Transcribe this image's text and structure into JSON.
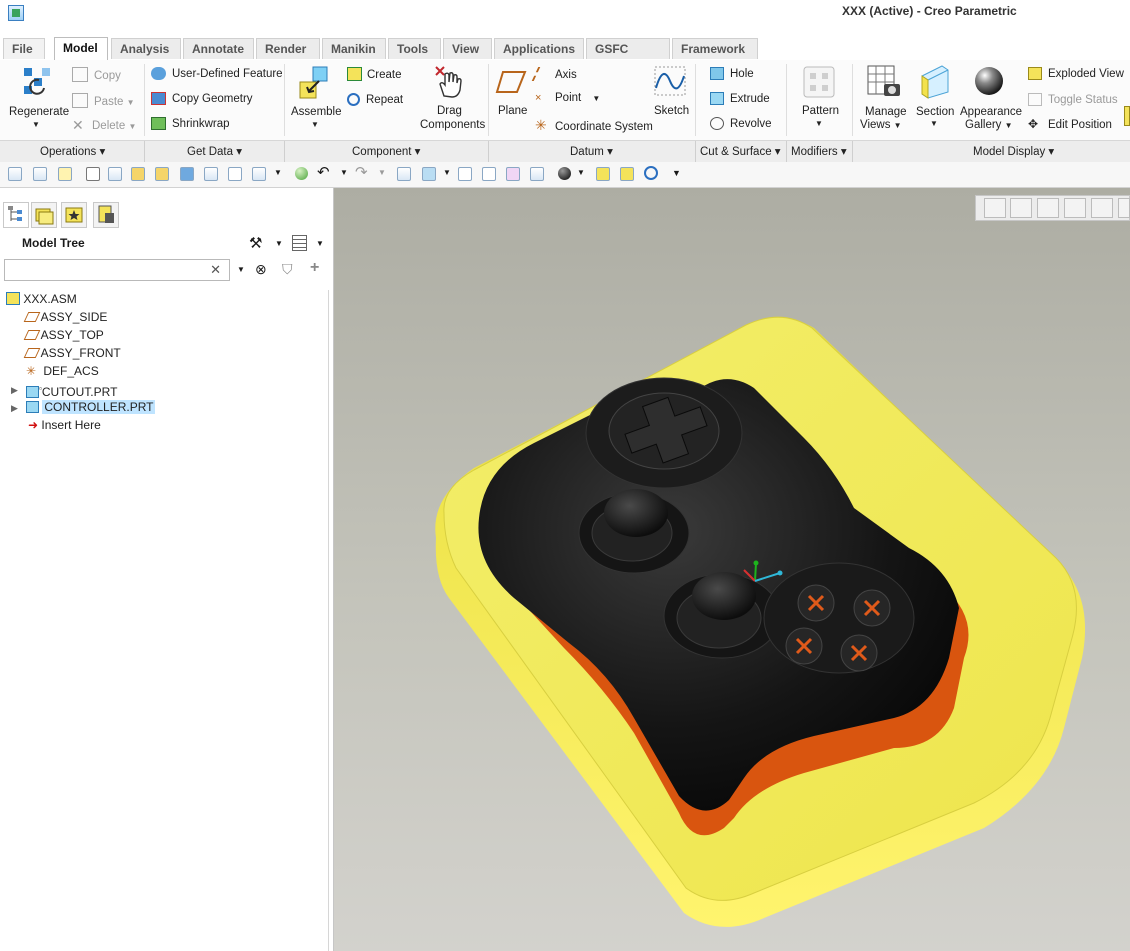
{
  "window": {
    "title": "XXX (Active) - Creo Parametric"
  },
  "tabs": [
    {
      "label": "File"
    },
    {
      "label": "Model"
    },
    {
      "label": "Analysis"
    },
    {
      "label": "Annotate"
    },
    {
      "label": "Render"
    },
    {
      "label": "Manikin"
    },
    {
      "label": "Tools"
    },
    {
      "label": "View"
    },
    {
      "label": "Applications"
    },
    {
      "label": "GSFC Tools"
    },
    {
      "label": "Framework"
    }
  ],
  "ribbon": {
    "regenerate": "Regenerate",
    "copy": "Copy",
    "paste": "Paste",
    "delete": "Delete",
    "user_defined_feature": "User-Defined Feature",
    "copy_geometry": "Copy Geometry",
    "shrinkwrap": "Shrinkwrap",
    "assemble": "Assemble",
    "create": "Create",
    "repeat": "Repeat",
    "drag": "Drag",
    "components": "Components",
    "plane": "Plane",
    "axis": "Axis",
    "point": "Point",
    "coordinate_system": "Coordinate System",
    "sketch": "Sketch",
    "hole": "Hole",
    "extrude": "Extrude",
    "revolve": "Revolve",
    "pattern": "Pattern",
    "manage": "Manage",
    "views": "Views",
    "section": "Section",
    "appearance": "Appearance",
    "gallery": "Gallery",
    "exploded_view": "Exploded View",
    "toggle_status": "Toggle Status",
    "edit_position": "Edit Position"
  },
  "groups": [
    {
      "label": "Operations"
    },
    {
      "label": "Get Data"
    },
    {
      "label": "Component"
    },
    {
      "label": "Datum"
    },
    {
      "label": "Cut & Surface"
    },
    {
      "label": "Modifiers"
    },
    {
      "label": "Model Display"
    }
  ],
  "model_tree": {
    "title": "Model Tree",
    "search_value": "",
    "items": [
      {
        "label": "XXX.ASM"
      },
      {
        "label": "ASSY_SIDE"
      },
      {
        "label": "ASSY_TOP"
      },
      {
        "label": "ASSY_FRONT"
      },
      {
        "label": "DEF_ACS"
      },
      {
        "label": "CUTOUT.PRT"
      },
      {
        "label": "CONTROLLER.PRT"
      },
      {
        "label": "Insert Here"
      }
    ]
  },
  "colors": {
    "tray": "#f0ea5a",
    "cavity": "#d9550f",
    "controller": "#111111",
    "buttons": "#e05a1a",
    "background_top": "#adada3",
    "selection": "#bfe4ff"
  }
}
